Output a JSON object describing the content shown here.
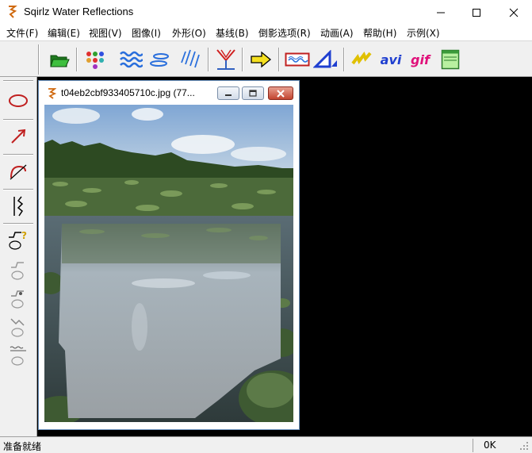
{
  "app": {
    "title": "Sqirlz Water Reflections"
  },
  "menu": [
    "文件(F)",
    "编辑(E)",
    "视图(V)",
    "图像(I)",
    "外形(O)",
    "基线(B)",
    "倒影选项(R)",
    "动画(A)",
    "帮助(H)",
    "示例(X)"
  ],
  "toolbar": {
    "avi_label": "avi",
    "gif_label": "gif",
    "colors": {
      "avi": "#1f3fd0",
      "gif": "#e0107a"
    }
  },
  "child_window": {
    "title": "t04eb2cbf933405710c.jpg  (77..."
  },
  "status": {
    "left": "准备就绪",
    "right": "0K"
  },
  "icons": {
    "toolbar": [
      "open-folder-icon",
      "dots-icon",
      "waves-icon",
      "ripples-icon",
      "rain-icon",
      "baseline-icon",
      "arrow-right-icon",
      "image-frame-icon",
      "triangle-icon",
      "zigzag-icon",
      "avi-icon",
      "gif-icon",
      "panel-icon"
    ],
    "left": [
      "ellipse-icon",
      "arrow-icon",
      "curve-icon",
      "zigzag-line-icon",
      "shape-help-icon",
      "shape-1-icon",
      "shape-2-icon",
      "shape-3-icon",
      "shape-4-icon"
    ]
  }
}
